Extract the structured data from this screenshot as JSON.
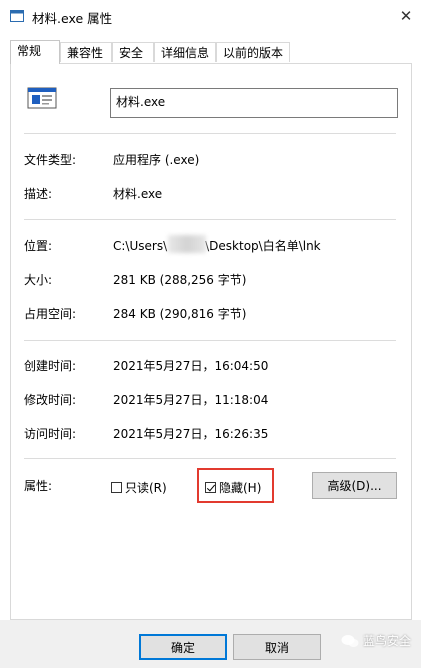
{
  "window": {
    "title": "材料.exe 属性",
    "close_glyph": "✕"
  },
  "tabs": [
    {
      "label": "常规",
      "active": true
    },
    {
      "label": "兼容性"
    },
    {
      "label": "安全"
    },
    {
      "label": "详细信息"
    },
    {
      "label": "以前的版本"
    }
  ],
  "general": {
    "file_name": "材料.exe",
    "type_label": "文件类型:",
    "type_value": "应用程序 (.exe)",
    "desc_label": "描述:",
    "desc_value": "材料.exe",
    "location_label": "位置:",
    "location_prefix": "C:\\Users\\",
    "location_suffix": "\\Desktop\\白名单\\lnk",
    "size_label": "大小:",
    "size_value": "281 KB (288,256 字节)",
    "disk_label": "占用空间:",
    "disk_value": "284 KB (290,816 字节)",
    "created_label": "创建时间:",
    "created_value": "2021年5月27日，16:04:50",
    "modified_label": "修改时间:",
    "modified_value": "2021年5月27日，11:18:04",
    "accessed_label": "访问时间:",
    "accessed_value": "2021年5月27日，16:26:35",
    "attributes_label": "属性:",
    "readonly_label": "只读(R)",
    "readonly_checked": false,
    "hidden_label": "隐藏(H)",
    "hidden_checked": true,
    "advanced_button": "高级(D)..."
  },
  "footer": {
    "ok_button": "确定",
    "cancel_button": "取消",
    "watermark": "蓝鸟安全"
  },
  "colors": {
    "highlight": "#e23a2f",
    "accent": "#0078d7"
  }
}
